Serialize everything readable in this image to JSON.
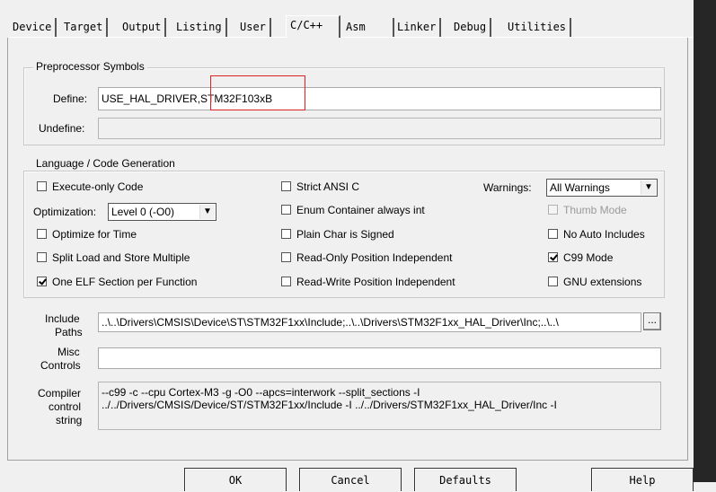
{
  "tabs": [
    "Device",
    "Target",
    "Output",
    "Listing",
    "User",
    "C/C++",
    "Asm",
    "Linker",
    "Debug",
    "Utilities"
  ],
  "active_tab": "C/C++",
  "preprocessor": {
    "group_title": "Preprocessor Symbols",
    "define_label": "Define:",
    "define_value": "USE_HAL_DRIVER,STM32F103xB",
    "undefine_label": "Undefine:",
    "undefine_value": ""
  },
  "language": {
    "group_title": "Language / Code Generation",
    "execute_only": {
      "label": "Execute-only Code",
      "checked": false
    },
    "optimization_label": "Optimization:",
    "optimization_value": "Level 0 (-O0)",
    "optimize_time": {
      "label": "Optimize for Time",
      "checked": false
    },
    "split_load_store": {
      "label": "Split Load and Store Multiple",
      "checked": false
    },
    "one_elf_section": {
      "label": "One ELF Section per Function",
      "checked": true
    },
    "strict_ansi": {
      "label": "Strict ANSI C",
      "checked": false
    },
    "enum_container": {
      "label": "Enum Container always int",
      "checked": false
    },
    "plain_char": {
      "label": "Plain Char is Signed",
      "checked": false
    },
    "ro_pi": {
      "label": "Read-Only Position Independent",
      "checked": false
    },
    "rw_pi": {
      "label": "Read-Write Position Independent",
      "checked": false
    },
    "warnings_label": "Warnings:",
    "warnings_value": "All Warnings",
    "thumb_mode": {
      "label": "Thumb Mode",
      "checked": false,
      "disabled": true
    },
    "no_auto_includes": {
      "label": "No Auto Includes",
      "checked": false
    },
    "c99_mode": {
      "label": "C99 Mode",
      "checked": true
    },
    "gnu_extensions": {
      "label": "GNU extensions",
      "checked": false
    }
  },
  "include": {
    "label_1": "Include",
    "label_2": "Paths",
    "value": "..\\..\\Drivers\\CMSIS\\Device\\ST\\STM32F1xx\\Include;..\\..\\Drivers\\STM32F1xx_HAL_Driver\\Inc;..\\..\\",
    "browse_label": "..."
  },
  "misc": {
    "label_1": "Misc",
    "label_2": "Controls",
    "value": ""
  },
  "compiler": {
    "label_1": "Compiler",
    "label_2": "control",
    "label_3": "string",
    "value": "--c99 -c --cpu Cortex-M3 -g -O0 --apcs=interwork --split_sections -I\n../../Drivers/CMSIS/Device/ST/STM32F1xx/Include -I ../../Drivers/STM32F1xx_HAL_Driver/Inc -I"
  },
  "buttons": {
    "ok": "OK",
    "cancel": "Cancel",
    "defaults": "Defaults",
    "help": "Help"
  },
  "colors": {
    "highlight_box": "#dd2222",
    "dark_edge": "#262626"
  }
}
